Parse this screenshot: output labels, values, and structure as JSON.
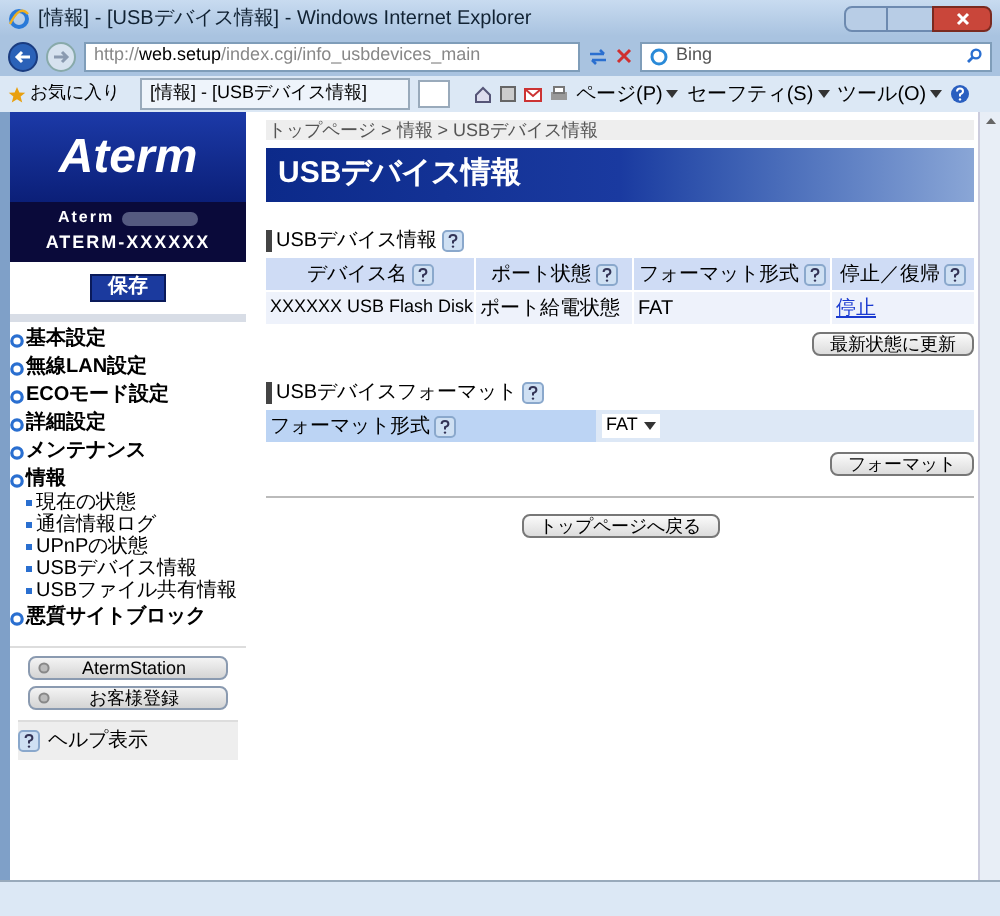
{
  "window": {
    "title": "[情報] - [USBデバイス情報] - Windows Internet Explorer"
  },
  "address_bar": {
    "url_prefix": "http://",
    "url_host": "web.setup",
    "url_path": "/index.cgi/info_usbdevices_main"
  },
  "search": {
    "placeholder": "Bing"
  },
  "toolbar": {
    "favorites": "お気に入り",
    "tab": "[情報] - [USBデバイス情報]",
    "menus": [
      "ページ(P)",
      "セーフティ(S)",
      "ツール(O)"
    ]
  },
  "sidebar": {
    "logo": "Aterm",
    "model": "Aterm",
    "device_name": "ATERM-XXXXXX",
    "save_button": "保存",
    "items": [
      {
        "label": "基本設定"
      },
      {
        "label": "無線LAN設定"
      },
      {
        "label": "ECOモード設定"
      },
      {
        "label": "詳細設定"
      },
      {
        "label": "メンテナンス"
      },
      {
        "label": "情報",
        "children": [
          {
            "label": "現在の状態"
          },
          {
            "label": "通信情報ログ"
          },
          {
            "label": "UPnPの状態"
          },
          {
            "label": "USBデバイス情報"
          },
          {
            "label": "USBファイル共有情報"
          }
        ]
      },
      {
        "label": "悪質サイトブロック"
      }
    ],
    "buttons": [
      "AtermStation",
      "お客様登録"
    ],
    "help": "ヘルプ表示"
  },
  "breadcrumb": "トップページ > 情報 > USBデバイス情報",
  "page_title": "USBデバイス情報",
  "device_section": {
    "title": "USBデバイス情報",
    "columns": [
      "デバイス名",
      "ポート状態",
      "フォーマット形式",
      "停止／復帰"
    ],
    "rows": [
      {
        "name": "XXXXXX USB Flash Disk",
        "port": "ポート給電状態",
        "format": "FAT",
        "action": "停止"
      }
    ],
    "refresh_button": "最新状態に更新"
  },
  "format_section": {
    "title": "USBデバイスフォーマット",
    "label": "フォーマット形式",
    "value": "FAT",
    "format_button": "フォーマット"
  },
  "back_button": "トップページへ戻る"
}
